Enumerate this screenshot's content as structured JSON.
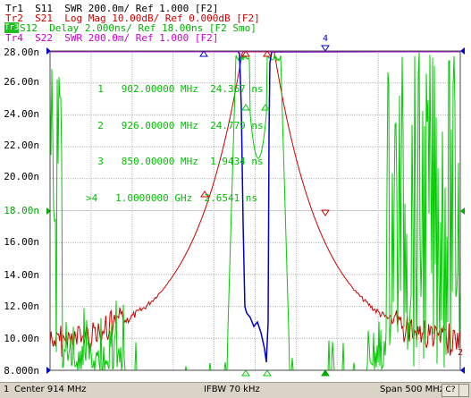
{
  "traces": [
    {
      "id": "tr1",
      "label": "Tr1  S11  SWR 200.0m/ Ref 1.000 [F2]",
      "color": "#3a3a3a",
      "active": false
    },
    {
      "id": "tr2",
      "label": "Tr2  S21  Log Mag 10.00dB/ Ref 0.000dB [F2]",
      "color": "#d00000",
      "active": false
    },
    {
      "id": "tr3",
      "label": "S12  Delay 2.000ns/ Ref 18.00ns [F2 Smo]",
      "color": "#1fbf1f",
      "active": true,
      "tag": "Tr3"
    },
    {
      "id": "tr4",
      "label": "Tr4  S22  SWR 200.0m/ Ref 1.000 [F2]",
      "color": "#cc00cc",
      "active": false
    }
  ],
  "y_axis": {
    "labels": [
      "28.00n",
      "26.00n",
      "24.00n",
      "22.00n",
      "20.00n",
      "18.00n",
      "16.00n",
      "14.00n",
      "12.00n",
      "10.00n",
      "8.000n"
    ],
    "ref_label_index": 5,
    "ref_color": "#00aa00"
  },
  "markers": {
    "rows": [
      "  1   902.00000 MHz  24.367 ns",
      "  2   926.00000 MHz  24.779 ns",
      "  3   850.00000 MHz  1.9434 ns",
      ">4   1.0000000 GHz  2.6541 ns"
    ]
  },
  "plot_annotations": {
    "top_marker_4": "4",
    "right_marker_2": "2"
  },
  "status_bar": {
    "channel": "1",
    "center": "Center 914 MHz",
    "ifbw": "IFBW 70 kHz",
    "span": "Span 500 MHz",
    "btn": "C?"
  },
  "colors": {
    "grid": "#b9b9b9",
    "s11": "#0000cc",
    "s21": "#cc0000",
    "s12": "#00cc00",
    "s22": "#cc00cc",
    "border": "#4a4a4a"
  }
}
